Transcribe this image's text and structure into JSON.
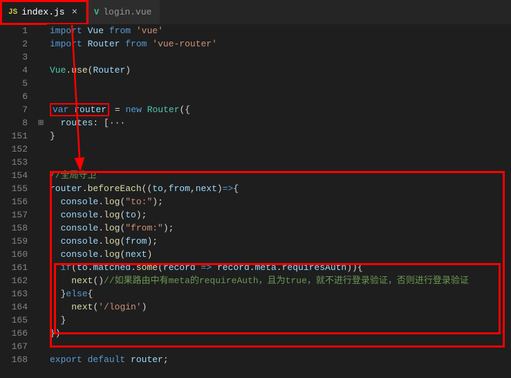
{
  "tabs": [
    {
      "icon": "JS",
      "name": "index.js",
      "active": true,
      "closable": true
    },
    {
      "icon": "V",
      "name": "login.vue",
      "active": false,
      "closable": false
    }
  ],
  "lines": [
    {
      "n": "1",
      "fold": "",
      "html": "<span class='kw'>import</span> <span class='var'>Vue</span> <span class='kw'>from</span> <span class='str'>'vue'</span>"
    },
    {
      "n": "2",
      "fold": "",
      "html": "<span class='kw'>import</span> <span class='var'>Router</span> <span class='kw'>from</span> <span class='str'>'vue-router'</span>"
    },
    {
      "n": "3",
      "fold": "",
      "html": ""
    },
    {
      "n": "4",
      "fold": "",
      "html": "<span class='type'>Vue</span><span class='punct'>.</span><span class='fn'>use</span><span class='punct'>(</span><span class='var'>Router</span><span class='punct'>)</span>"
    },
    {
      "n": "5",
      "fold": "",
      "html": ""
    },
    {
      "n": "6",
      "fold": "",
      "html": ""
    },
    {
      "n": "7",
      "fold": "",
      "html": "<span class='hl-var'><span class='kw'>var</span> <span class='var'>router</span></span> <span class='op'>=</span> <span class='kw'>new</span> <span class='type'>Router</span><span class='punct'>({</span>"
    },
    {
      "n": "8",
      "fold": "⊞",
      "html": "  <span class='var'>routes</span><span class='punct'>:</span> <span class='punct'>[</span><span class='punct'>···</span>"
    },
    {
      "n": "151",
      "fold": "",
      "html": "<span class='punct'>}</span>"
    },
    {
      "n": "152",
      "fold": "",
      "html": ""
    },
    {
      "n": "153",
      "fold": "",
      "html": ""
    },
    {
      "n": "154",
      "fold": "",
      "html": "<span class='cmt'>//全局守卫</span>"
    },
    {
      "n": "155",
      "fold": "",
      "html": "<span class='var'>router</span><span class='punct'>.</span><span class='fn'>beforeEach</span><span class='punct'>((</span><span class='var'>to</span><span class='punct'>,</span><span class='var'>from</span><span class='punct'>,</span><span class='var'>next</span><span class='punct'>)</span><span class='kw'>=&gt;</span><span class='punct'>{</span>"
    },
    {
      "n": "156",
      "fold": "",
      "html": "  <span class='var'>console</span><span class='punct'>.</span><span class='fn'>log</span><span class='punct'>(</span><span class='str'>\"to:\"</span><span class='punct'>);</span>"
    },
    {
      "n": "157",
      "fold": "",
      "html": "  <span class='var'>console</span><span class='punct'>.</span><span class='fn'>log</span><span class='punct'>(</span><span class='var'>to</span><span class='punct'>);</span>"
    },
    {
      "n": "158",
      "fold": "",
      "html": "  <span class='var'>console</span><span class='punct'>.</span><span class='fn'>log</span><span class='punct'>(</span><span class='str'>\"from:\"</span><span class='punct'>);</span>"
    },
    {
      "n": "159",
      "fold": "",
      "html": "  <span class='var'>console</span><span class='punct'>.</span><span class='fn'>log</span><span class='punct'>(</span><span class='var'>from</span><span class='punct'>);</span>"
    },
    {
      "n": "160",
      "fold": "",
      "html": "  <span class='var'>console</span><span class='punct'>.</span><span class='fn'>log</span><span class='punct'>(</span><span class='var'>next</span><span class='punct'>)</span>"
    },
    {
      "n": "161",
      "fold": "",
      "html": "  <span class='kw'>if</span><span class='punct'>(</span><span class='var'>to</span><span class='punct'>.</span><span class='var'>matched</span><span class='punct'>.</span><span class='fn'>some</span><span class='punct'>(</span><span class='var'>record</span> <span class='kw'>=&gt;</span> <span class='var'>record</span><span class='punct'>.</span><span class='var'>meta</span><span class='punct'>.</span><span class='var'>requiresAuth</span><span class='punct'>)){</span>"
    },
    {
      "n": "162",
      "fold": "",
      "html": "    <span class='fn'>next</span><span class='punct'>()</span><span class='cmt'>//如果路由中有meta的requireAuth，且为true，就不进行登录验证，否则进行登录验证</span>"
    },
    {
      "n": "163",
      "fold": "",
      "html": "  <span class='punct'>}</span><span class='kw'>else</span><span class='punct'>{</span>"
    },
    {
      "n": "164",
      "fold": "",
      "html": "    <span class='fn'>next</span><span class='punct'>(</span><span class='str'>'/login'</span><span class='punct'>)</span>"
    },
    {
      "n": "165",
      "fold": "",
      "html": "  <span class='punct'>}</span>"
    },
    {
      "n": "166",
      "fold": "",
      "html": "<span class='punct'>})</span>"
    },
    {
      "n": "167",
      "fold": "",
      "html": ""
    },
    {
      "n": "168",
      "fold": "",
      "html": "<span class='kw'>export</span> <span class='kw'>default</span> <span class='var'>router</span><span class='punct'>;</span>"
    }
  ]
}
